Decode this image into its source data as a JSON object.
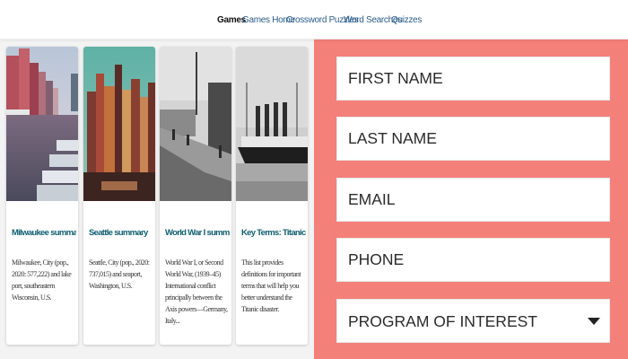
{
  "nav": {
    "items": [
      {
        "label": "Games",
        "active": true
      },
      {
        "label": "Games Home",
        "active": false
      },
      {
        "label": "Crossword Puzzles",
        "active": false
      },
      {
        "label": "Word Searches",
        "active": false
      },
      {
        "label": "Quizzes",
        "active": false
      }
    ]
  },
  "cards": [
    {
      "title": "Milwaukee summary",
      "description": "Milwaukee, City (pop., 2020: 577,222) and lake port, southeastern Wisconsin, U.S.",
      "image": "city-waterfront"
    },
    {
      "title": "Seattle summary",
      "description": "Seattle, City (pop., 2020: 737,015) and seaport, Washington, U.S.",
      "image": "city-skyline"
    },
    {
      "title": "World War I summary",
      "description": "World War I, or Second World War, (1939–45) International conflict principally between the Axis powers—Germany, Italy...",
      "image": "wartime-photo"
    },
    {
      "title": "Key Terms: Titanic",
      "description": "This list provides definitions for important terms that will help you better understand the Titanic disaster.",
      "image": "ship-photo"
    }
  ],
  "form": {
    "first_name_placeholder": "FIRST NAME",
    "last_name_placeholder": "LAST NAME",
    "email_placeholder": "EMAIL",
    "phone_placeholder": "PHONE",
    "program_label": "PROGRAM OF INTEREST",
    "background_color": "#f4807a"
  }
}
